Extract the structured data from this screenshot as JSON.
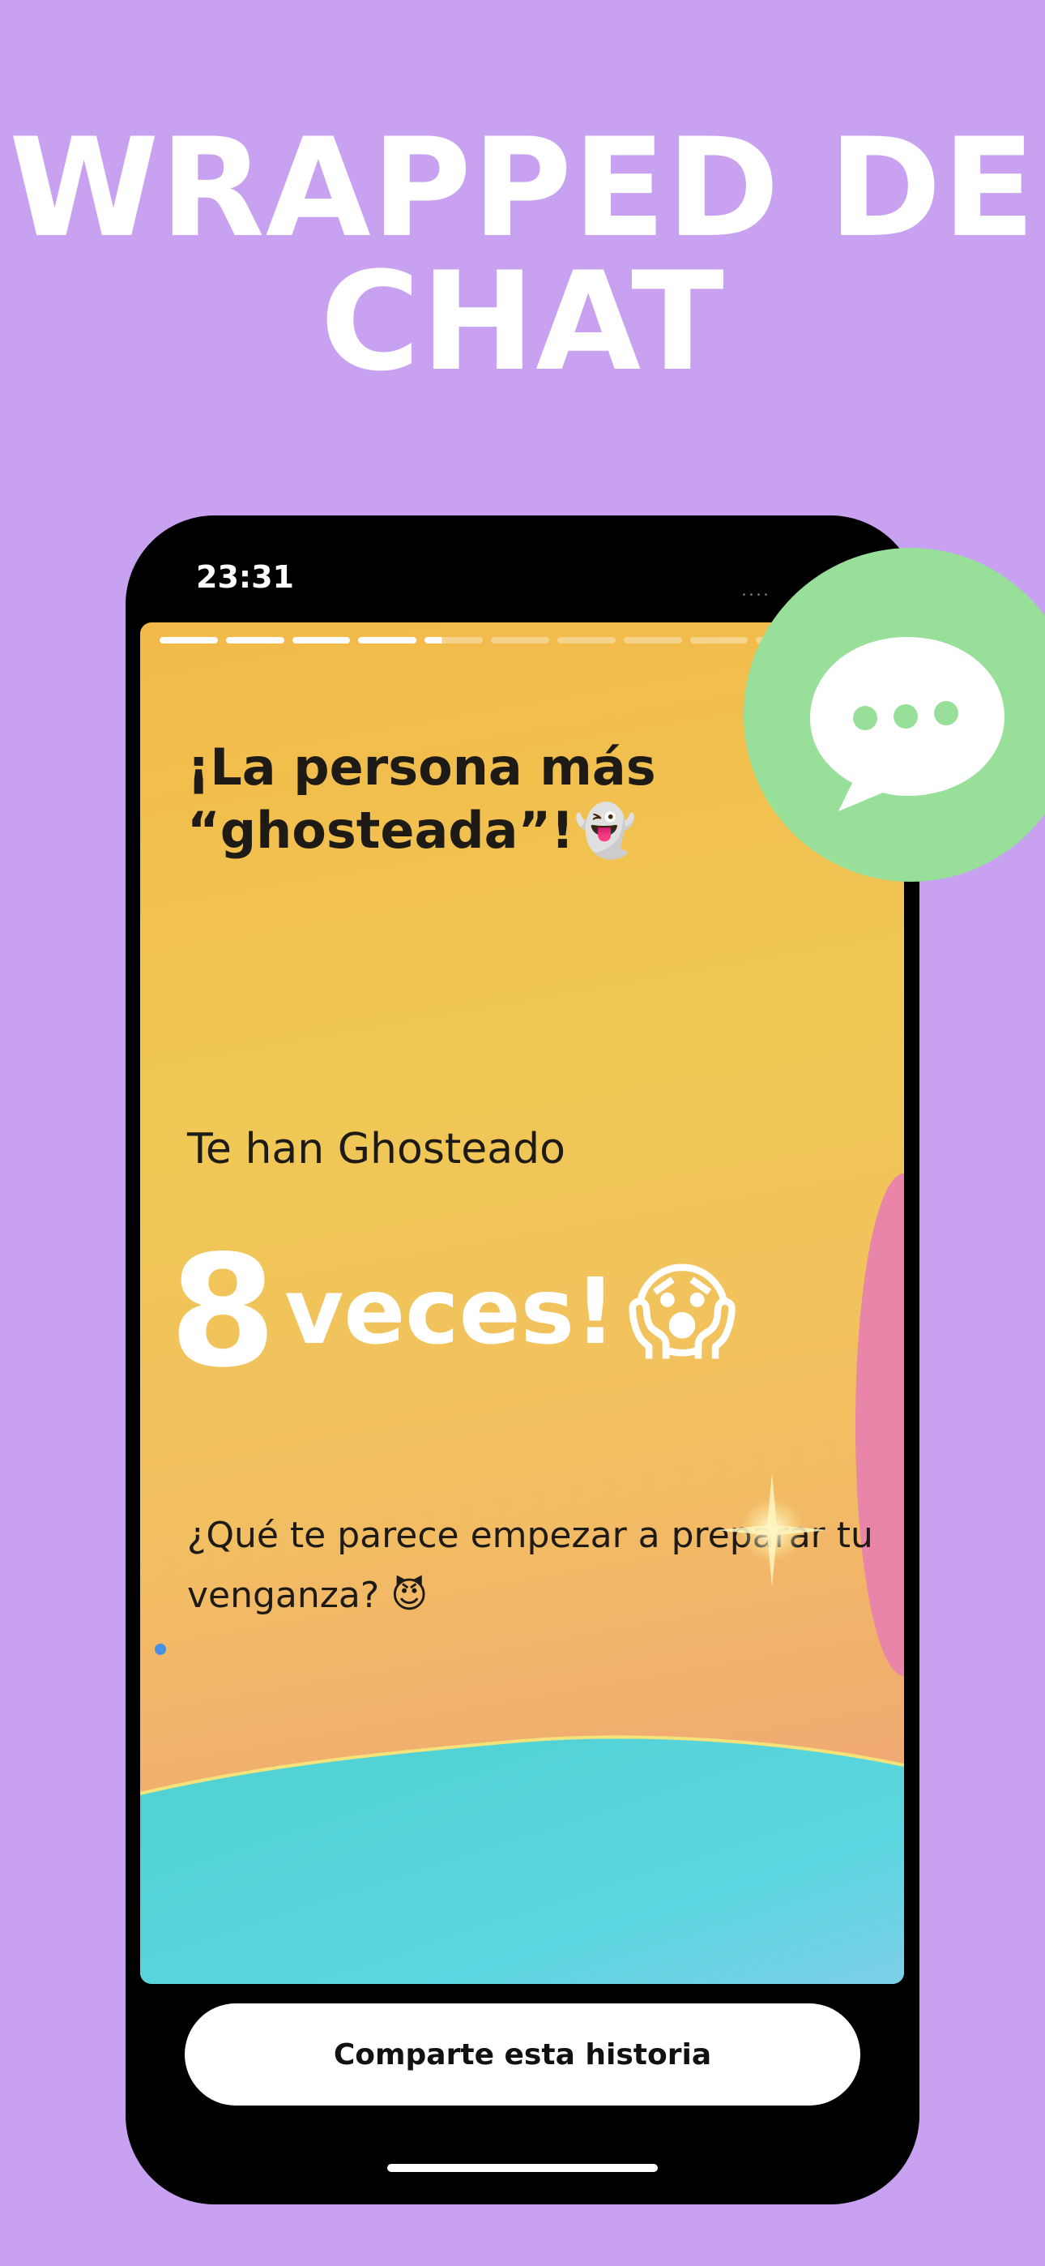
{
  "headline": {
    "line1": "WRAPPED DE",
    "line2": "CHAT"
  },
  "status": {
    "time": "23:31",
    "signal_dots": "....",
    "wifi_icon": "wifi-icon"
  },
  "story": {
    "progress": {
      "total_segments": 11,
      "completed_segments": 4,
      "current_segment_fraction": 0.3
    },
    "title_line1": "¡La persona más",
    "title_line2": "“ghosteada”!",
    "title_emoji": "👻",
    "subtitle": "Te han Ghosteado",
    "count_number": "8",
    "count_word": "veces!",
    "count_emoji": "😱",
    "body": "¿Qué te parece empezar a preparar tu venganza?",
    "body_emoji": "😈"
  },
  "share_button": {
    "label": "Comparte esta historia"
  },
  "badge": {
    "icon": "chat-bubble-icon",
    "color": "#98e09a"
  },
  "colors": {
    "background": "#c8a2f0",
    "badge": "#98e09a",
    "accent_text": "#ffffff"
  }
}
